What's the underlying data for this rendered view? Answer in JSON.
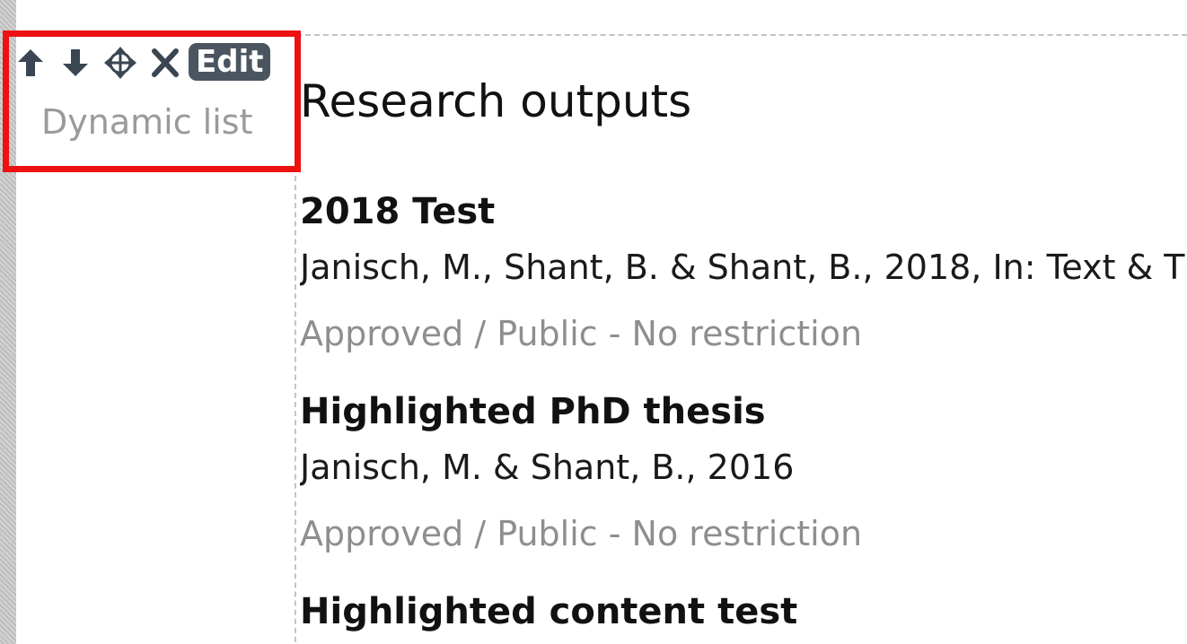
{
  "toolbar": {
    "icons": [
      "arrow-up-icon",
      "arrow-down-icon",
      "move-icon",
      "close-icon"
    ],
    "edit_label": "Edit",
    "widget_type": "Dynamic list",
    "highlight_color": "#ee1111",
    "edit_bg": "#4a5560"
  },
  "section": {
    "title": "Research outputs"
  },
  "items": [
    {
      "title": "2018 Test",
      "authors": "Janisch, M., Shant, B. & Shant, B., 2018, In: Text & T",
      "status": "Approved / Public - No restriction"
    },
    {
      "title": "Highlighted PhD thesis",
      "authors": "Janisch, M. & Shant, B., 2016",
      "status": "Approved / Public - No restriction"
    },
    {
      "title": "Highlighted content test"
    }
  ]
}
